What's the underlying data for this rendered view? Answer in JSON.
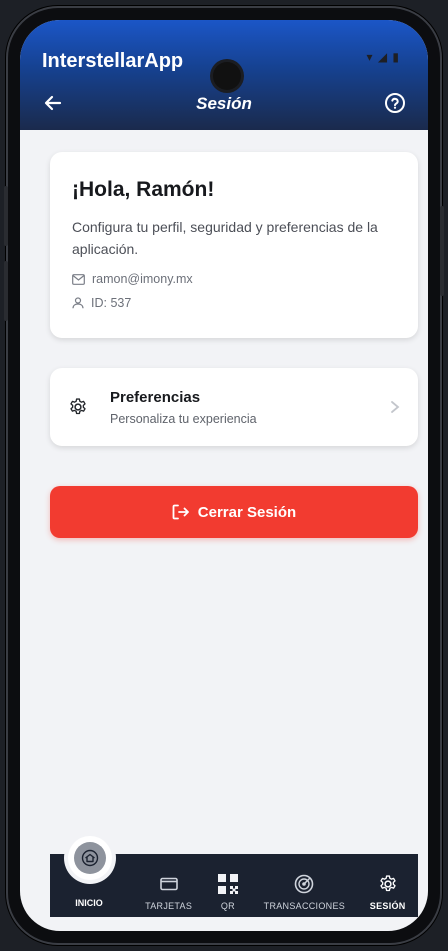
{
  "app": {
    "name": "InterstellarApp",
    "screen_title": "Sesión",
    "status": "▾ ◢ ▮"
  },
  "icons": {
    "back": "arrow-left-icon",
    "help": "question-circle-icon",
    "email": "mail-icon",
    "id": "user-icon",
    "preferences": "gear-icon",
    "chevron": "chevron-right-icon",
    "logout": "logout-icon"
  },
  "profile": {
    "greeting": "¡Hola, Ramón!",
    "description": "Configura tu perfil, seguridad y preferencias de la aplicación.",
    "email": "ramon@imony.mx",
    "id": "ID: 537"
  },
  "preferences": {
    "title": "Preferencias",
    "subtitle": "Personaliza tu experiencia"
  },
  "logout": {
    "label": "Cerrar Sesión"
  },
  "nav": {
    "items": [
      {
        "label": "INICIO",
        "icon": "home-icon",
        "active": false
      },
      {
        "label": "TARJETAS",
        "icon": "card-icon",
        "active": false
      },
      {
        "label": "QR",
        "icon": "qr-icon",
        "active": false
      },
      {
        "label": "TRANSACCIONES",
        "icon": "target-icon",
        "active": false
      },
      {
        "label": "SESIÓN",
        "icon": "gear-icon",
        "active": true
      }
    ]
  },
  "colors": {
    "primary": "#16418f",
    "danger": "#f23b30",
    "nav_bg": "#1b2230",
    "background": "#f2f3f6"
  }
}
